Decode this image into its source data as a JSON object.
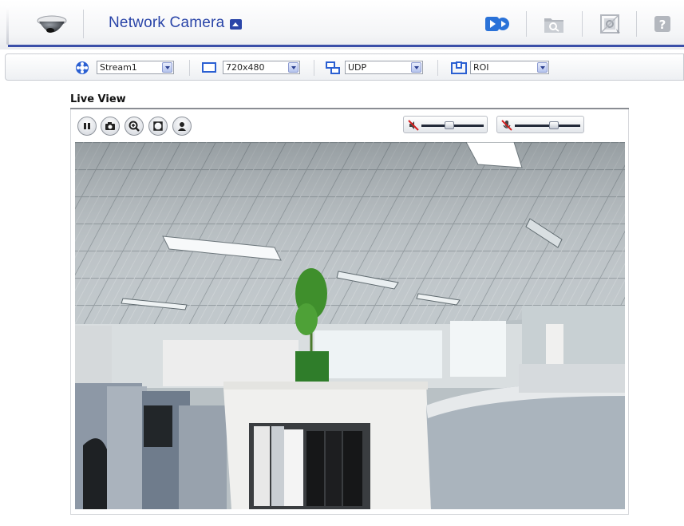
{
  "header": {
    "brand": "Network Camera",
    "nav": [
      "live-view",
      "search",
      "setup",
      "help"
    ]
  },
  "toolbar": {
    "stream": {
      "icon": "stream-icon",
      "value": "Stream1"
    },
    "resolution": {
      "icon": "resolution-icon",
      "value": "720x480"
    },
    "protocol": {
      "icon": "protocol-icon",
      "value": "UDP"
    },
    "roi": {
      "icon": "roi-icon",
      "value": "ROI"
    }
  },
  "live": {
    "title": "Live View",
    "controls": [
      "pause-icon",
      "snapshot-icon",
      "zoom-icon",
      "fullscreen-icon",
      "record-icon"
    ],
    "speaker_volume": 0.45,
    "mic_volume": 0.6
  },
  "colors": {
    "brand_blue": "#2a45a8",
    "header_rule": "#3b4fa8",
    "active_nav": "#2a72d8"
  }
}
